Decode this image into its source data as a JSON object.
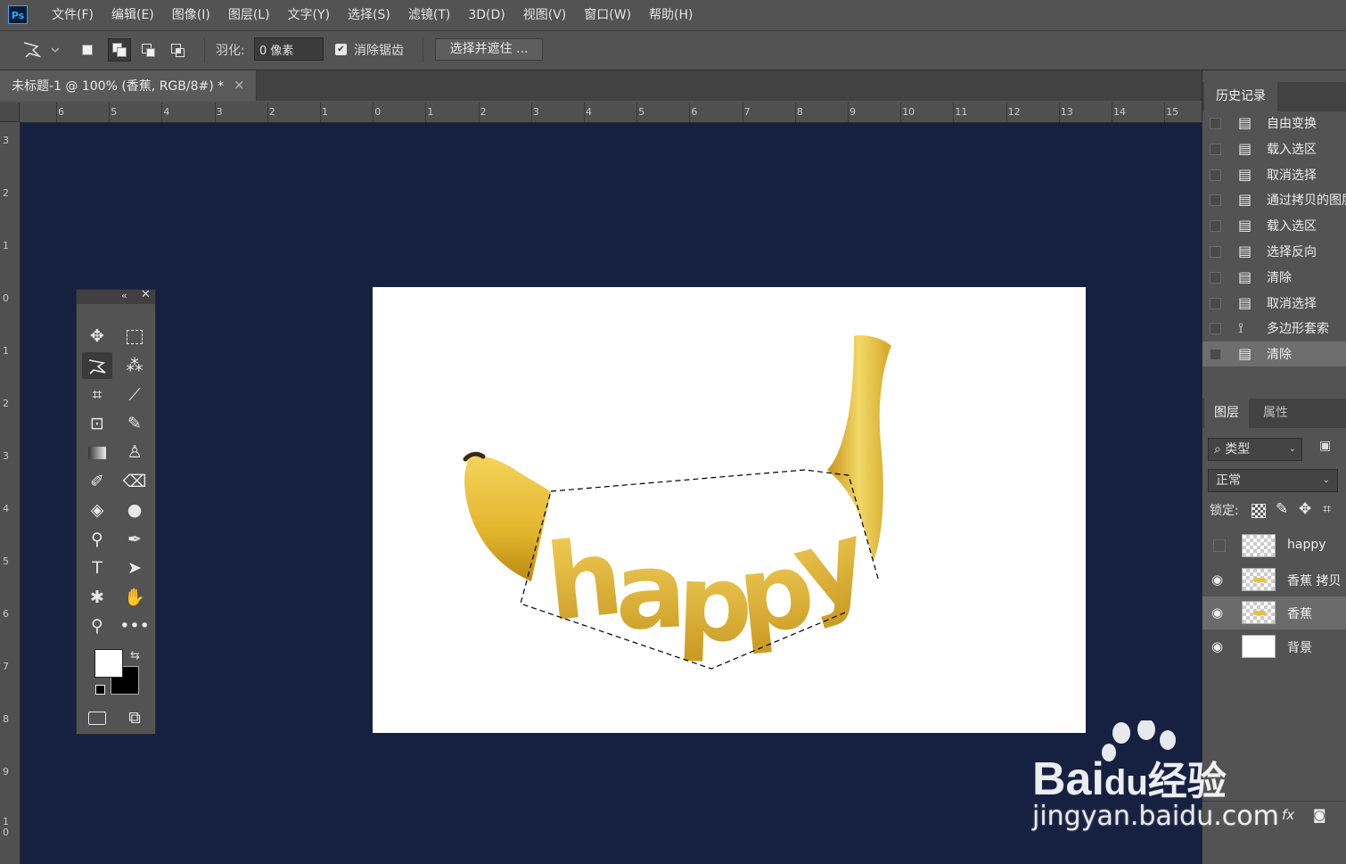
{
  "app": {
    "logo_text": "Ps"
  },
  "menu": [
    "文件(F)",
    "编辑(E)",
    "图像(I)",
    "图层(L)",
    "文字(Y)",
    "选择(S)",
    "滤镜(T)",
    "3D(D)",
    "视图(V)",
    "窗口(W)",
    "帮助(H)"
  ],
  "options": {
    "feather_label": "羽化:",
    "feather_value": "0 像素",
    "antialias_label": "消除锯齿",
    "antialias_checked": true,
    "select_mask_label": "选择并遮住 ..."
  },
  "document": {
    "tab_title": "未标题-1 @ 100% (香蕉, RGB/8#) *",
    "close_glyph": "×",
    "canvas_text": "happy"
  },
  "rulers": {
    "top": [
      "6",
      "5",
      "4",
      "3",
      "2",
      "1",
      "0",
      "1",
      "2",
      "3",
      "4",
      "5",
      "6",
      "7",
      "8",
      "9",
      "10",
      "11",
      "12",
      "13",
      "14",
      "15"
    ],
    "left": [
      "3",
      "2",
      "1",
      "0",
      "1",
      "2",
      "3",
      "4",
      "5",
      "6",
      "7",
      "8",
      "9",
      "1",
      "0"
    ]
  },
  "history": {
    "tab_label": "历史记录",
    "items": [
      "自由变换",
      "载入选区",
      "取消选择",
      "通过拷贝的图层",
      "载入选区",
      "选择反向",
      "清除",
      "取消选择",
      "多边形套索",
      "清除"
    ]
  },
  "layers": {
    "tab_label": "图层",
    "props_tab_label": "属性",
    "kind_label": "类型",
    "blend_mode": "正常",
    "lock_label": "锁定:",
    "items": [
      {
        "name": "happy",
        "visible": false
      },
      {
        "name": "香蕉 拷贝",
        "visible": true
      },
      {
        "name": "香蕉",
        "visible": true
      },
      {
        "name": "背景",
        "visible": true
      }
    ],
    "footer_fx": "fx"
  },
  "colors": {
    "canvas_bg": "#162040",
    "fg": "#ffffff",
    "bg": "#000000",
    "banana": "#e8c13a"
  },
  "watermark": {
    "logo": "Bai",
    "logo_du": "du",
    "logo_suffix": "经验",
    "url": "jingyan.baidu.com"
  }
}
